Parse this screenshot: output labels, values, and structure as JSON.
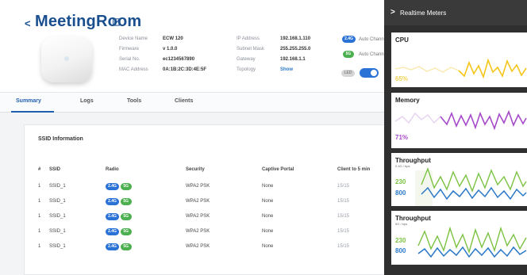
{
  "header": {
    "back_glyph": "<",
    "title": "MeetingRoom",
    "col1": [
      {
        "k": "Device Name",
        "v": "ECW 120"
      },
      {
        "k": "Firmware",
        "v": "v 1.0.0"
      },
      {
        "k": "Serial No.",
        "v": "ec1234567890"
      },
      {
        "k": "MAC Address",
        "v": "0A:1B:2C:3D:4E:5F"
      }
    ],
    "col2": [
      {
        "k": "IP Address",
        "v": "192.168.1.110"
      },
      {
        "k": "Subnet Mask",
        "v": "255.255.255.0"
      },
      {
        "k": "Gateway",
        "v": "192.168.1.1"
      },
      {
        "k": "Topology",
        "v": "Show"
      }
    ],
    "badges": [
      {
        "label": "2.4G",
        "note": "Auto Channel"
      },
      {
        "label": "5G",
        "note": "Auto Channel"
      },
      {
        "label": "LED",
        "note": ""
      }
    ]
  },
  "tabs": [
    "Summary",
    "Logs",
    "Tools",
    "Clients"
  ],
  "card": {
    "title": "SSID Information",
    "headers": {
      "num": "#",
      "ssid": "SSID",
      "radio": "Radio",
      "security": "Security",
      "portal": "Captive Portal",
      "clients": "Client to 5 min"
    },
    "radio_labels": {
      "a": "2.4G",
      "b": "5G"
    },
    "rows": [
      {
        "num": "1",
        "ssid": "SSID_1",
        "security": "WPA2 PSK",
        "portal": "None",
        "clients": "15/15"
      },
      {
        "num": "1",
        "ssid": "SSID_1",
        "security": "WPA2 PSK",
        "portal": "None",
        "clients": "15/15"
      },
      {
        "num": "1",
        "ssid": "SSID_1",
        "security": "WPA2 PSK",
        "portal": "None",
        "clients": "15/15"
      },
      {
        "num": "1",
        "ssid": "SSID_1",
        "security": "WPA2 PSK",
        "portal": "None",
        "clients": "15/15"
      },
      {
        "num": "1",
        "ssid": "SSID_1",
        "security": "WPA2 PSK",
        "portal": "None",
        "clients": "15/15"
      }
    ]
  },
  "meters": {
    "title": "Realtime Meters",
    "chevron": ">",
    "cpu": {
      "title": "CPU",
      "percent": "65%",
      "color": "#f5c518"
    },
    "memory": {
      "title": "Memory",
      "percent": "71%",
      "color": "#a64ac9"
    },
    "throughput1": {
      "title": "Throughput",
      "subtitle": "2.4G / bps",
      "up": "230",
      "down": "800",
      "up_color": "#7cc242",
      "down_color": "#2a78c8"
    },
    "throughput2": {
      "title": "Throughput",
      "subtitle": "5G / bps",
      "up": "230",
      "down": "800",
      "up_color": "#7cc242",
      "down_color": "#2a78c8"
    }
  },
  "colors": {
    "brand": "#1a4f8f",
    "accent": "#2a72d6",
    "panel": "#2f2f2f"
  }
}
